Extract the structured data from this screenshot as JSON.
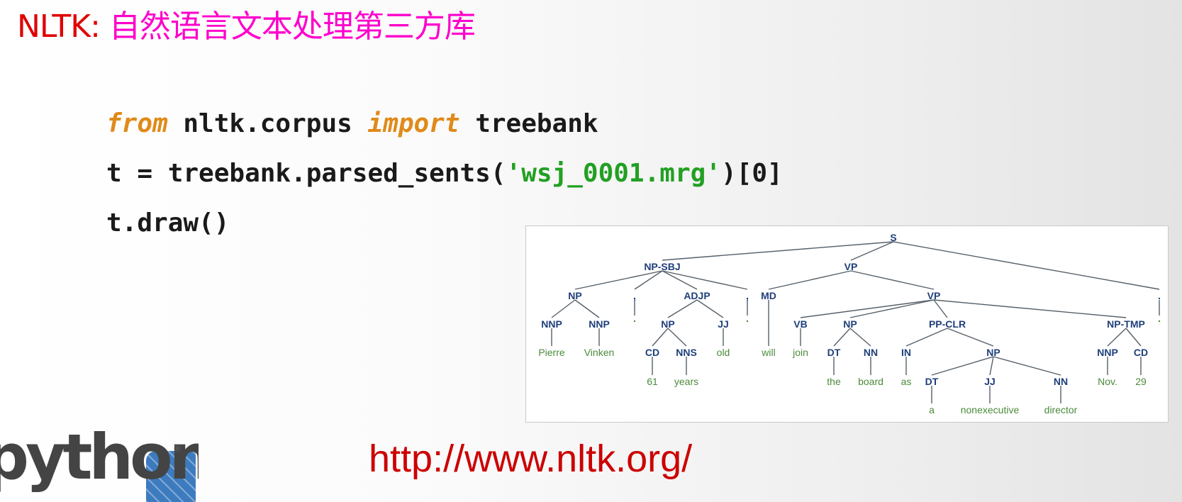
{
  "slide": {
    "title_prefix": "NLTK: ",
    "title_main": "自然语言文本处理第三方库",
    "url": "http://www.nltk.org/"
  },
  "code": {
    "line1": {
      "kw1": "from",
      "mod": " nltk.corpus ",
      "kw2": "import",
      "name": " treebank"
    },
    "line2": {
      "prefix": "t = treebank.parsed_sents(",
      "str": "'wsj_0001.mrg'",
      "suffix": ")[0]"
    },
    "line3": "t.draw()"
  },
  "logo": {
    "text": "python",
    "registered": "®"
  },
  "parse_tree": {
    "labels": [
      "S",
      "NP-SBJ",
      "VP",
      "NP",
      ",",
      "ADJP",
      ",",
      "MD",
      "VP",
      "NNP",
      "NNP",
      "NP",
      "JJ",
      "VB",
      "NP",
      "PP-CLR",
      "NP-TMP",
      "CD",
      "NNS",
      "DT",
      "NN",
      "IN",
      "NP",
      "NNP",
      "CD",
      "DT",
      "JJ",
      "NN",
      "."
    ],
    "words": [
      "Pierre",
      "Vinken",
      "61",
      "years",
      "old",
      "will",
      "join",
      "the",
      "board",
      "as",
      "a",
      "nonexecutive",
      "director",
      "Nov.",
      "29"
    ]
  },
  "colors": {
    "title_prefix": "#e00000",
    "title_main": "#ff00cc",
    "keyword": "#e08a1a",
    "string": "#22a022",
    "url": "#cc0000",
    "tree_label": "#1f3f7a",
    "tree_word": "#4a8a3a"
  }
}
